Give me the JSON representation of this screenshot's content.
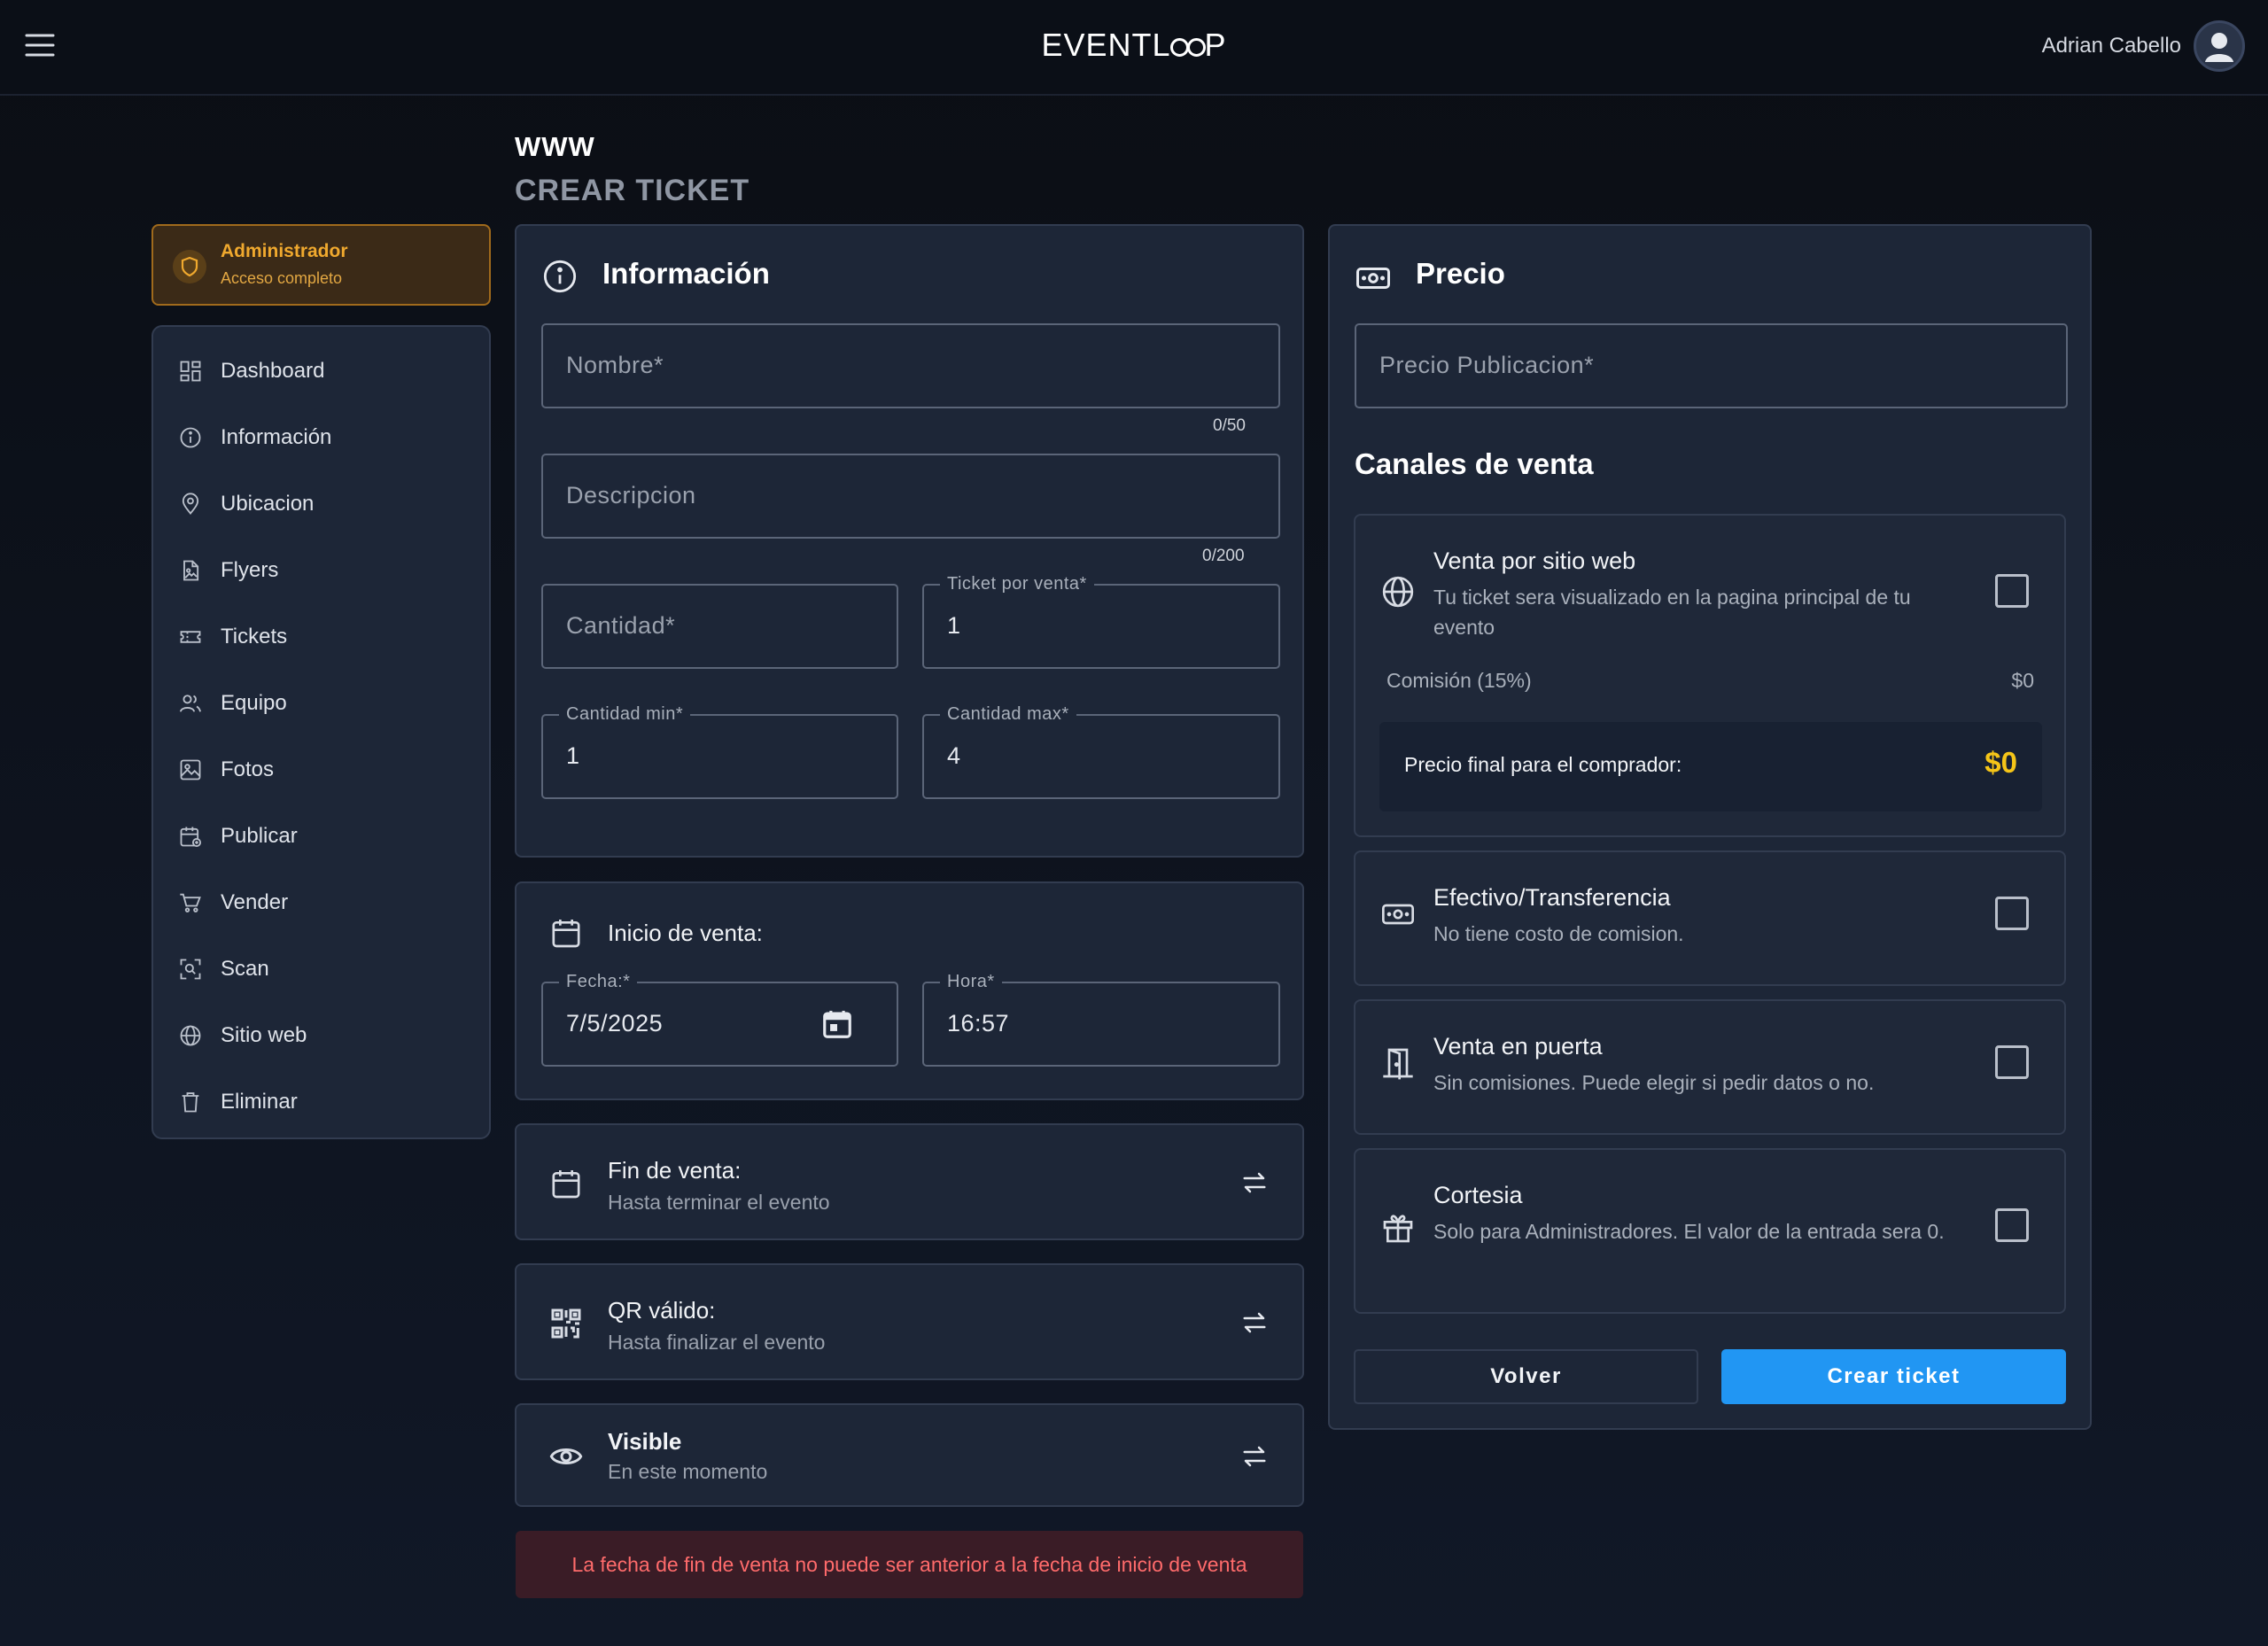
{
  "header": {
    "logo_left": "EVENTL",
    "logo_right": "P",
    "user_name": "Adrian Cabello"
  },
  "page": {
    "event_name": "WWW",
    "title": "CREAR TICKET"
  },
  "role": {
    "title": "Administrador",
    "subtitle": "Acceso completo",
    "accent": "#f0a92e"
  },
  "sidebar": {
    "items": [
      {
        "label": "Dashboard",
        "icon": "dashboard-icon"
      },
      {
        "label": "Información",
        "icon": "info-icon"
      },
      {
        "label": "Ubicacion",
        "icon": "location-pin-icon"
      },
      {
        "label": "Flyers",
        "icon": "image-file-icon"
      },
      {
        "label": "Tickets",
        "icon": "ticket-icon"
      },
      {
        "label": "Equipo",
        "icon": "team-icon"
      },
      {
        "label": "Fotos",
        "icon": "photo-icon"
      },
      {
        "label": "Publicar",
        "icon": "calendar-publish-icon"
      },
      {
        "label": "Vender",
        "icon": "cart-icon"
      },
      {
        "label": "Scan",
        "icon": "scan-icon"
      },
      {
        "label": "Sitio web",
        "icon": "globe-icon"
      },
      {
        "label": "Eliminar",
        "icon": "trash-icon"
      }
    ]
  },
  "info": {
    "title": "Información",
    "nombre_placeholder": "Nombre*",
    "nombre_counter": "0/50",
    "descripcion_placeholder": "Descripcion",
    "descripcion_counter": "0/200",
    "cantidad_placeholder": "Cantidad*",
    "ticket_por_venta_label": "Ticket por venta*",
    "ticket_por_venta_value": "1",
    "cantidad_min_label": "Cantidad min*",
    "cantidad_min_value": "1",
    "cantidad_max_label": "Cantidad max*",
    "cantidad_max_value": "4"
  },
  "inicio": {
    "title": "Inicio de venta:",
    "fecha_label": "Fecha:*",
    "fecha_value": "7/5/2025",
    "hora_label": "Hora*",
    "hora_value": "16:57"
  },
  "fin": {
    "title": "Fin de venta:",
    "subtitle": "Hasta terminar el evento"
  },
  "qr": {
    "title": "QR válido:",
    "subtitle": "Hasta finalizar el evento"
  },
  "visible": {
    "title": "Visible",
    "subtitle": "En este momento"
  },
  "error": "La fecha de fin de venta no puede ser anterior a la fecha de inicio de venta",
  "precio": {
    "title": "Precio",
    "precio_placeholder": "Precio Publicacion*",
    "canales_title": "Canales de venta",
    "web": {
      "title": "Venta por sitio web",
      "subtitle": "Tu ticket sera visualizado en la pagina principal de tu evento",
      "comision_label": "Comisión (15%)",
      "comision_value": "$0",
      "final_label": "Precio final para el comprador:",
      "final_value": "$0",
      "checked": false
    },
    "efectivo": {
      "title": "Efectivo/Transferencia",
      "subtitle": "No tiene costo de comision.",
      "checked": false
    },
    "puerta": {
      "title": "Venta en puerta",
      "subtitle": "Sin comisiones. Puede elegir si pedir datos o no.",
      "checked": false
    },
    "cortesia": {
      "title": "Cortesia",
      "subtitle": "Solo para Administradores. El valor de la entrada sera 0.",
      "checked": false
    },
    "volver_label": "Volver",
    "crear_label": "Crear ticket"
  },
  "colors": {
    "primary_button": "#2196f3",
    "price_highlight": "#f5c518",
    "error_text": "#ff6b6b"
  }
}
